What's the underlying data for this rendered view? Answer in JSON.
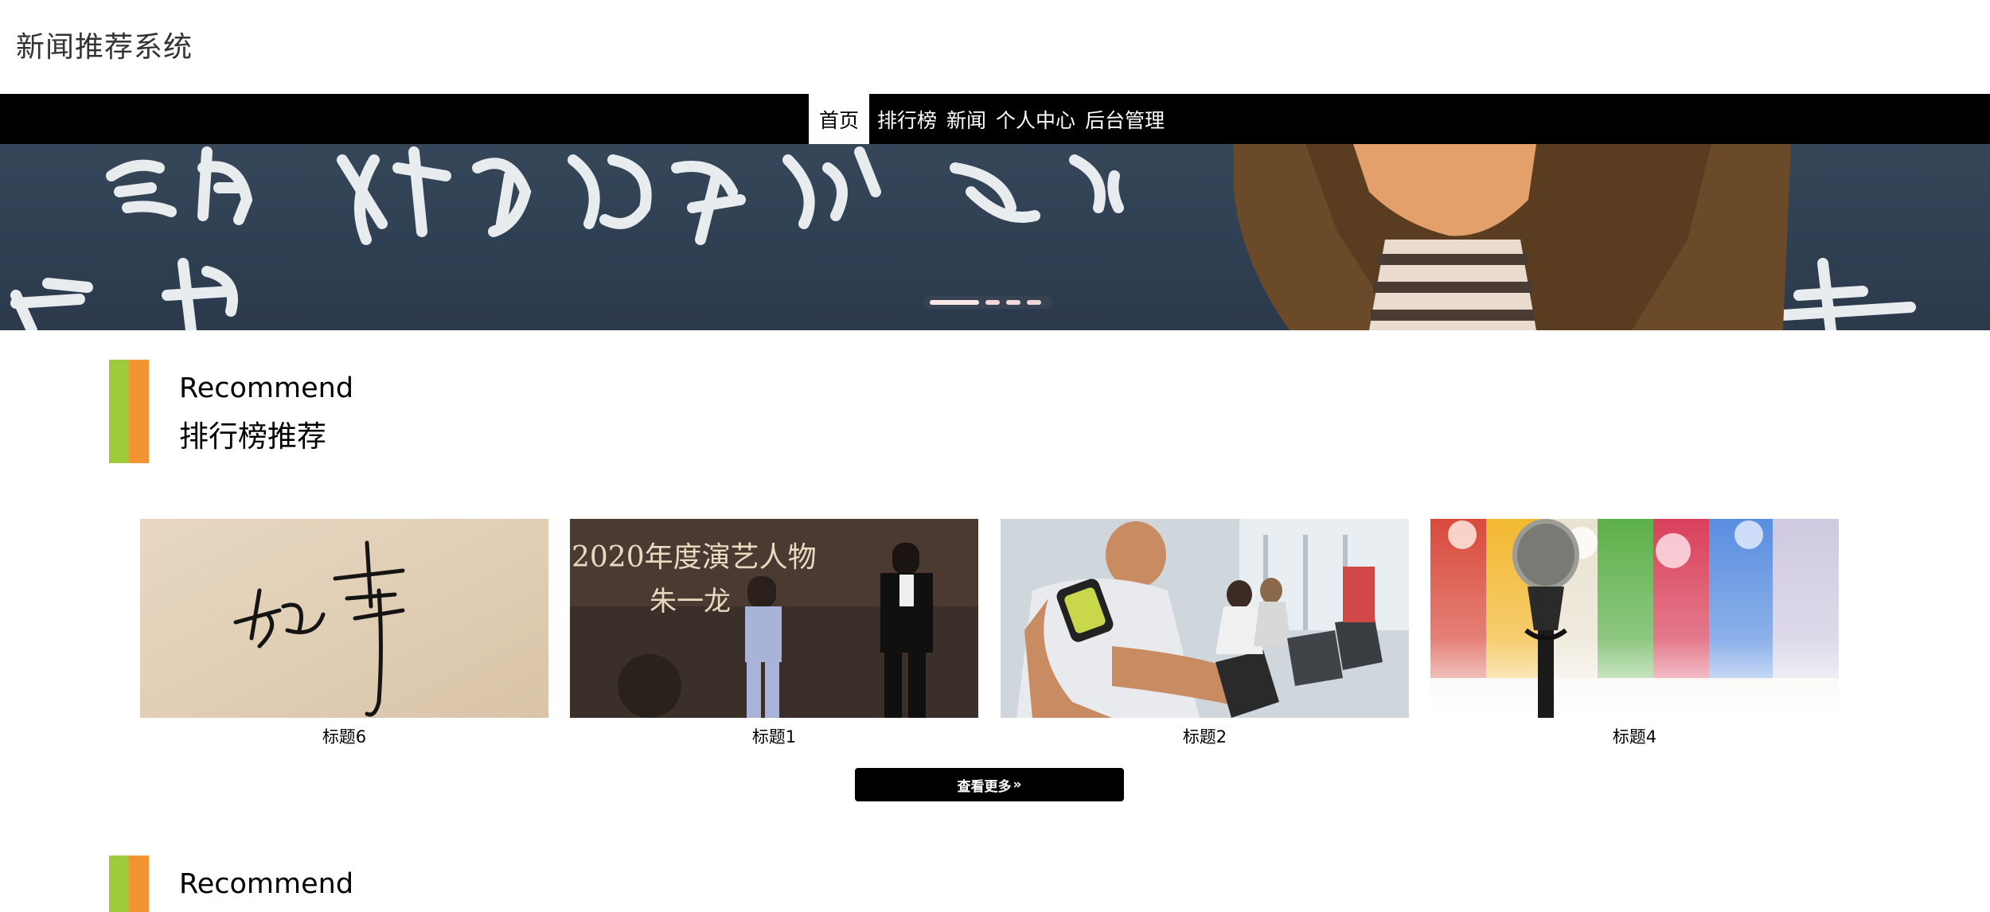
{
  "header": {
    "site_title": "新闻推荐系统"
  },
  "nav": {
    "items": [
      {
        "label": "首页",
        "active": true
      },
      {
        "label": "排行榜"
      },
      {
        "label": "新闻"
      },
      {
        "label": "个人中心"
      },
      {
        "label": "后台管理"
      }
    ]
  },
  "banner": {
    "active_slide": 1,
    "slide_count": 4
  },
  "sections": [
    {
      "title_en": "Recommend",
      "title_cn": "排行榜推荐"
    },
    {
      "title_en": "Recommend"
    }
  ],
  "cards": [
    {
      "caption": "标题6"
    },
    {
      "caption": "标题1",
      "image_text_1": "2020年度演艺人物",
      "image_text_2": "朱一龙"
    },
    {
      "caption": "标题2"
    },
    {
      "caption": "标题4"
    }
  ],
  "more_button": {
    "label": "查看更多",
    "icon": "double-chevron-right-icon"
  },
  "colors": {
    "nav_bg": "#000000",
    "accent_green": "#9ecb3c",
    "accent_orange": "#f29431"
  }
}
